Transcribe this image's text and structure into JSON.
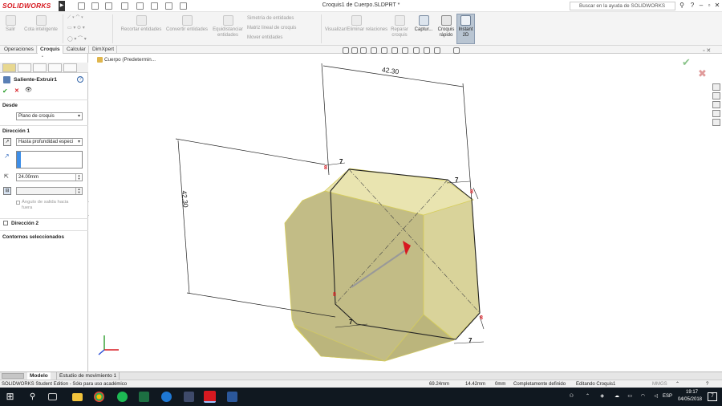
{
  "app": {
    "name": "SOLIDWORKS",
    "document_title": "Croquis1 de Cuerpo.SLDPRT *"
  },
  "search": {
    "placeholder": "Buscar en la ayuda de SOLIDWORKS"
  },
  "ribbon": {
    "salir": "Salir",
    "cota": "Cota inteligente",
    "recortar": "Recortar entidades",
    "convertir": "Convertir entidades",
    "equidistanciar": "Equidistanciar entidades",
    "simetria": "Simetría de entidades",
    "matriz": "Matriz lineal de croquis",
    "mover": "Mover entidades",
    "visualizar": "Visualizar/Eliminar relaciones",
    "reparar": "Reparar croquis",
    "captura": "Captur...",
    "croquis_rapido": "Croquis rápido",
    "instant2d": "Instant 2D"
  },
  "command_tabs": [
    "Operaciones",
    "Croquis",
    "Calcular",
    "DimXpert"
  ],
  "breadcrumb": "Cuerpo  (Predetermin...",
  "property_manager": {
    "title": "Saliente-Extruir1",
    "ok": "✔",
    "cancel": "✕",
    "preview": "👁",
    "desde_label": "Desde",
    "desde_value": "Plano de croquis",
    "direccion1_label": "Dirección 1",
    "end_condition": "Hasta profundidad especi",
    "depth": "24.00mm",
    "draft_label": "Ángulo de salida hacia fuera",
    "direccion2_label": "Dirección 2",
    "contornos_label": "Contornos seleccionados"
  },
  "dimensions": {
    "top": "42.30",
    "left": "42.30",
    "small": "7",
    "small_v": "8"
  },
  "bottom_tabs": [
    "Modelo",
    "Estudio de movimiento 1"
  ],
  "status": {
    "edition": "SOLIDWORKS Student Edition - Sólo para uso académico",
    "x": "69.24mm",
    "y": "14.42mm",
    "z": "0mm",
    "state": "Completamente definido",
    "editing": "Editando Croquis1",
    "units": "MMGS"
  },
  "taskbar": {
    "lang": "ESP",
    "time": "19:17",
    "date": "04/05/2018",
    "notifications": "7"
  },
  "colors": {
    "accent": "#d71920",
    "face": "#e8e2a0",
    "face_dark": "#b8b27a"
  }
}
